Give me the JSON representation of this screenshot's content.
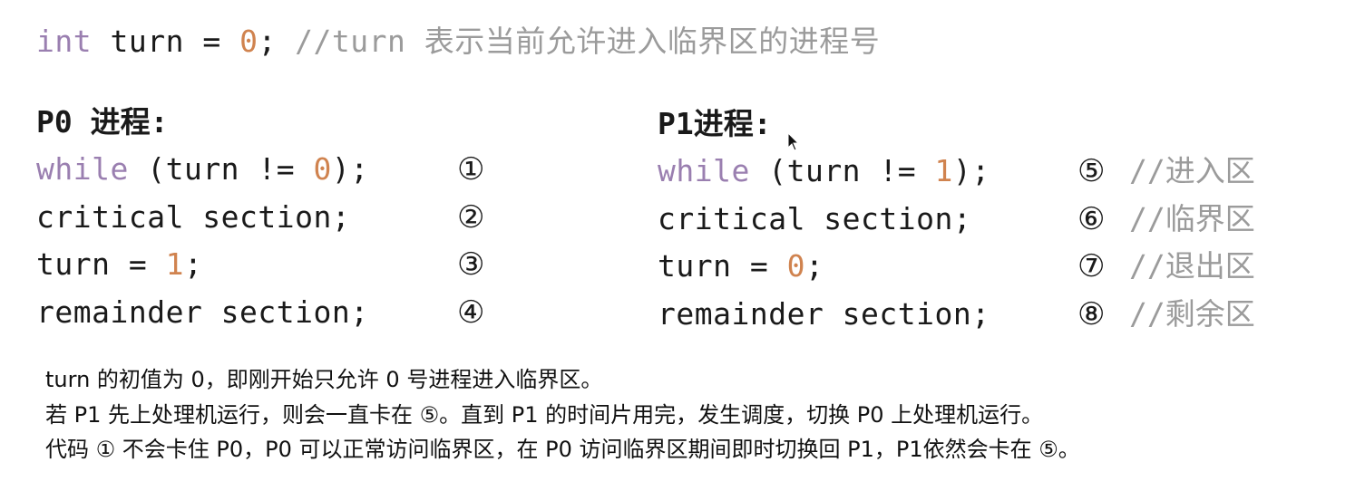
{
  "declaration": {
    "keyword": "int",
    "name": " turn = ",
    "value": "0",
    "end": ";",
    "comment": " //turn 表示当前允许进入临界区的进程号"
  },
  "p0": {
    "heading": "P0 进程:",
    "lines": [
      {
        "kw": "while",
        "pre": " (turn != ",
        "num": "0",
        "post": ");",
        "marker": "①"
      },
      {
        "text": "critical section;",
        "marker": "②"
      },
      {
        "pre": "turn = ",
        "num": "1",
        "post": ";",
        "marker": "③"
      },
      {
        "text": "remainder section;",
        "marker": "④"
      }
    ]
  },
  "p1": {
    "heading": "P1进程:",
    "lines": [
      {
        "kw": "while",
        "pre": " (turn != ",
        "num": "1",
        "post": ");",
        "marker": "⑤",
        "comment": "//进入区"
      },
      {
        "text": "critical section;",
        "marker": "⑥",
        "comment": "//临界区"
      },
      {
        "pre": "turn = ",
        "num": "0",
        "post": ";",
        "marker": "⑦",
        "comment": "//退出区"
      },
      {
        "text": "remainder section;",
        "marker": "⑧",
        "comment": "//剩余区"
      }
    ]
  },
  "notes": [
    "turn 的初值为 0，即刚开始只允许 0 号进程进入临界区。",
    "若 P1 先上处理机运行，则会一直卡在 ⑤。直到 P1 的时间片用完，发生调度，切换 P0 上处理机运行。",
    "代码 ① 不会卡住 P0，P0 可以正常访问临界区，在 P0 访问临界区期间即时切换回 P1，P1依然会卡在 ⑤。"
  ],
  "colors": {
    "keyword": "#9a7fb0",
    "number": "#d0834f",
    "comment": "#9b9b9b",
    "text": "#1a1a1a"
  },
  "icons": {
    "cursor": "mouse-pointer-icon"
  }
}
